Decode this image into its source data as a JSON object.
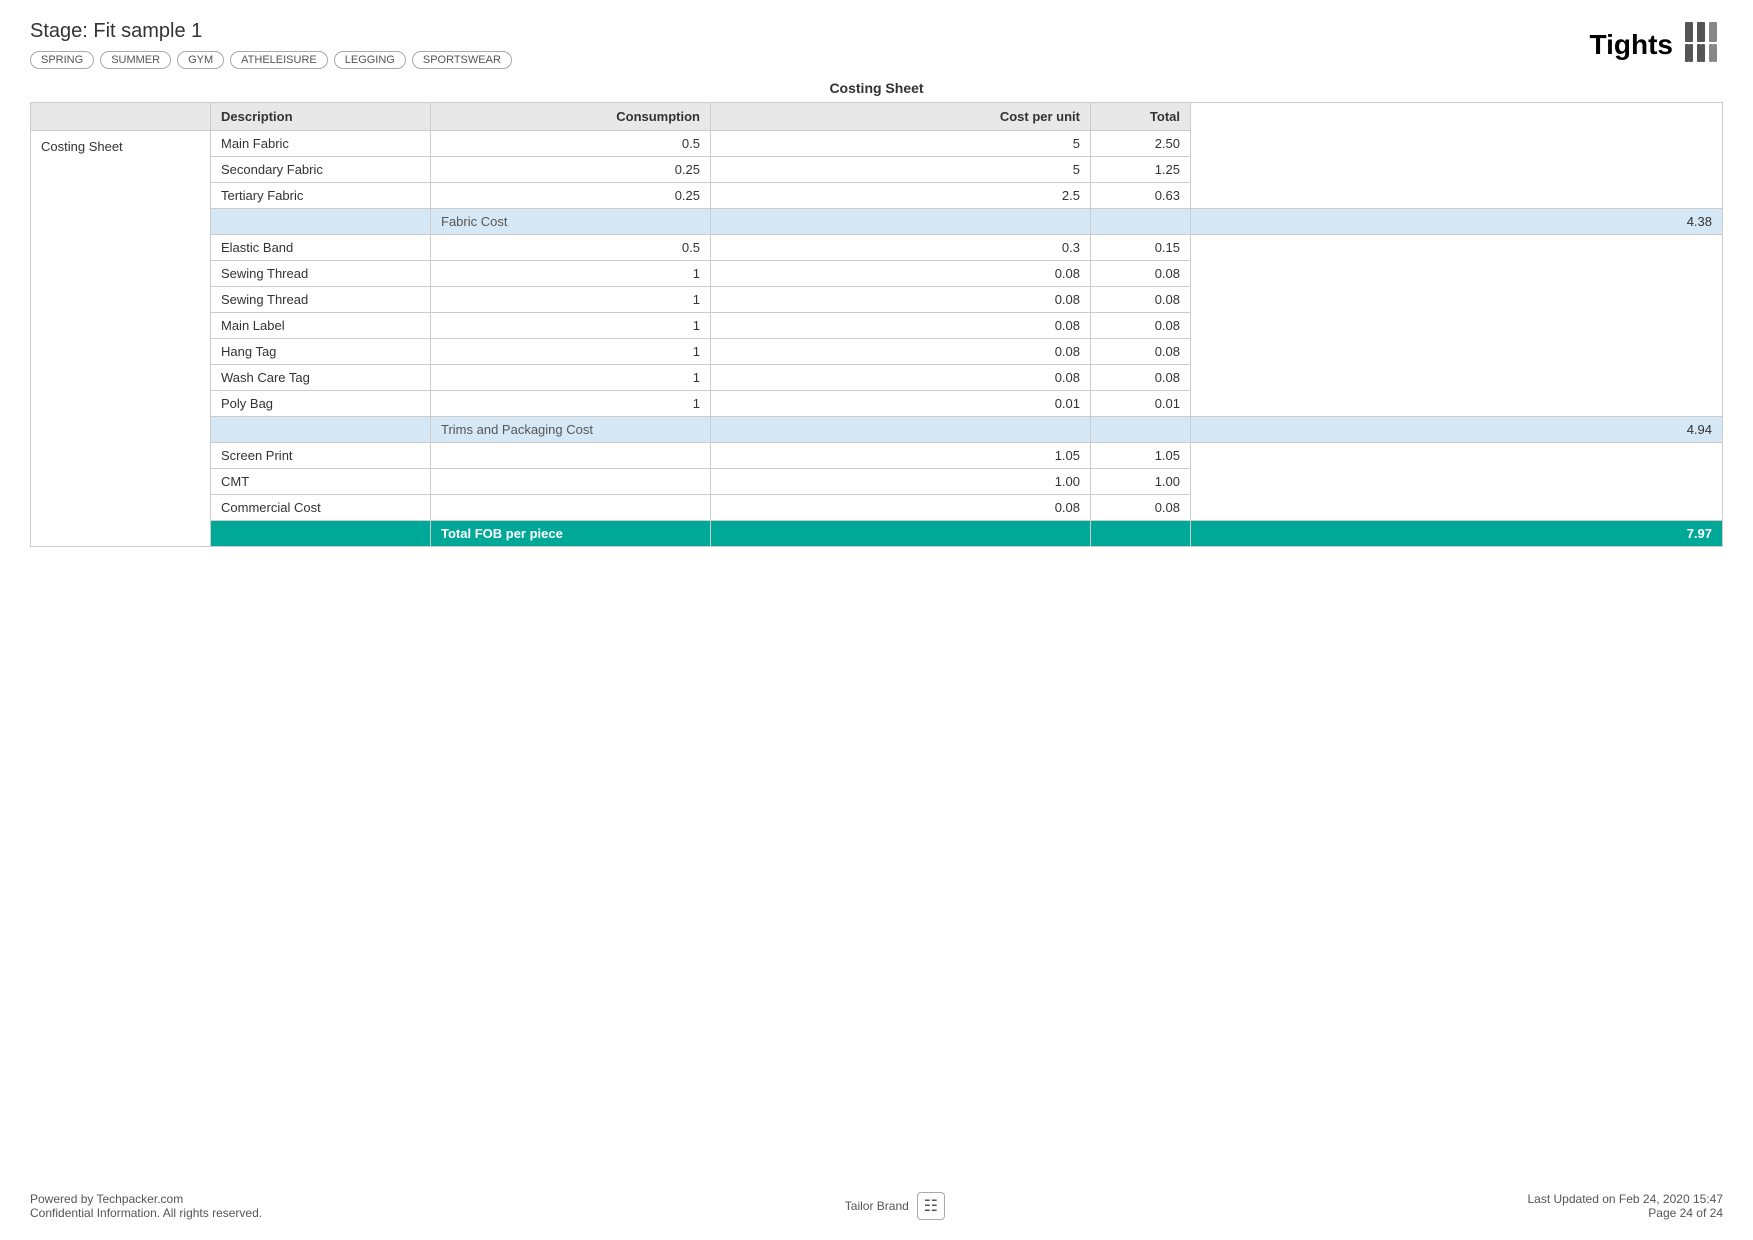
{
  "header": {
    "stage_title": "Stage: Fit sample 1",
    "product_name": "Tights",
    "tags": [
      "SPRING",
      "SUMMER",
      "GYM",
      "ATHELEISURE",
      "LEGGING",
      "SPORTSWEAR"
    ]
  },
  "costing_sheet": {
    "title": "Costing Sheet",
    "section_label": "Costing Sheet",
    "columns": {
      "description": "Description",
      "consumption": "Consumption",
      "cost_per_unit": "Cost per unit",
      "total": "Total"
    },
    "rows": [
      {
        "type": "data",
        "description": "Main Fabric",
        "consumption": "0.5",
        "cost_per_unit": "5",
        "total": "2.50"
      },
      {
        "type": "data",
        "description": "Secondary Fabric",
        "consumption": "0.25",
        "cost_per_unit": "5",
        "total": "1.25"
      },
      {
        "type": "data",
        "description": "Tertiary Fabric",
        "consumption": "0.25",
        "cost_per_unit": "2.5",
        "total": "0.63"
      },
      {
        "type": "subtotal",
        "description": "Fabric Cost",
        "consumption": "",
        "cost_per_unit": "",
        "total": "4.38"
      },
      {
        "type": "data",
        "description": "Elastic Band",
        "consumption": "0.5",
        "cost_per_unit": "0.3",
        "total": "0.15"
      },
      {
        "type": "data",
        "description": "Sewing Thread",
        "consumption": "1",
        "cost_per_unit": "0.08",
        "total": "0.08"
      },
      {
        "type": "data",
        "description": "Sewing Thread",
        "consumption": "1",
        "cost_per_unit": "0.08",
        "total": "0.08"
      },
      {
        "type": "data",
        "description": "Main Label",
        "consumption": "1",
        "cost_per_unit": "0.08",
        "total": "0.08"
      },
      {
        "type": "data",
        "description": "Hang Tag",
        "consumption": "1",
        "cost_per_unit": "0.08",
        "total": "0.08"
      },
      {
        "type": "data",
        "description": "Wash Care Tag",
        "consumption": "1",
        "cost_per_unit": "0.08",
        "total": "0.08"
      },
      {
        "type": "data",
        "description": "Poly Bag",
        "consumption": "1",
        "cost_per_unit": "0.01",
        "total": "0.01"
      },
      {
        "type": "subtotal",
        "description": "Trims and Packaging Cost",
        "consumption": "",
        "cost_per_unit": "",
        "total": "4.94"
      },
      {
        "type": "data",
        "description": "Screen Print",
        "consumption": "",
        "cost_per_unit": "1.05",
        "total": "1.05"
      },
      {
        "type": "data",
        "description": "CMT",
        "consumption": "",
        "cost_per_unit": "1.00",
        "total": "1.00"
      },
      {
        "type": "data",
        "description": "Commercial Cost",
        "consumption": "",
        "cost_per_unit": "0.08",
        "total": "0.08"
      },
      {
        "type": "total_fob",
        "description": "Total FOB per piece",
        "consumption": "",
        "cost_per_unit": "",
        "total": "7.97"
      }
    ]
  },
  "footer": {
    "left_line1": "Powered by Techpacker.com",
    "left_line2": "Confidential Information. All rights reserved.",
    "center_brand": "Tailor Brand",
    "right_line1": "Last Updated on Feb 24, 2020 15:47",
    "right_line2": "Page 24 of 24"
  }
}
